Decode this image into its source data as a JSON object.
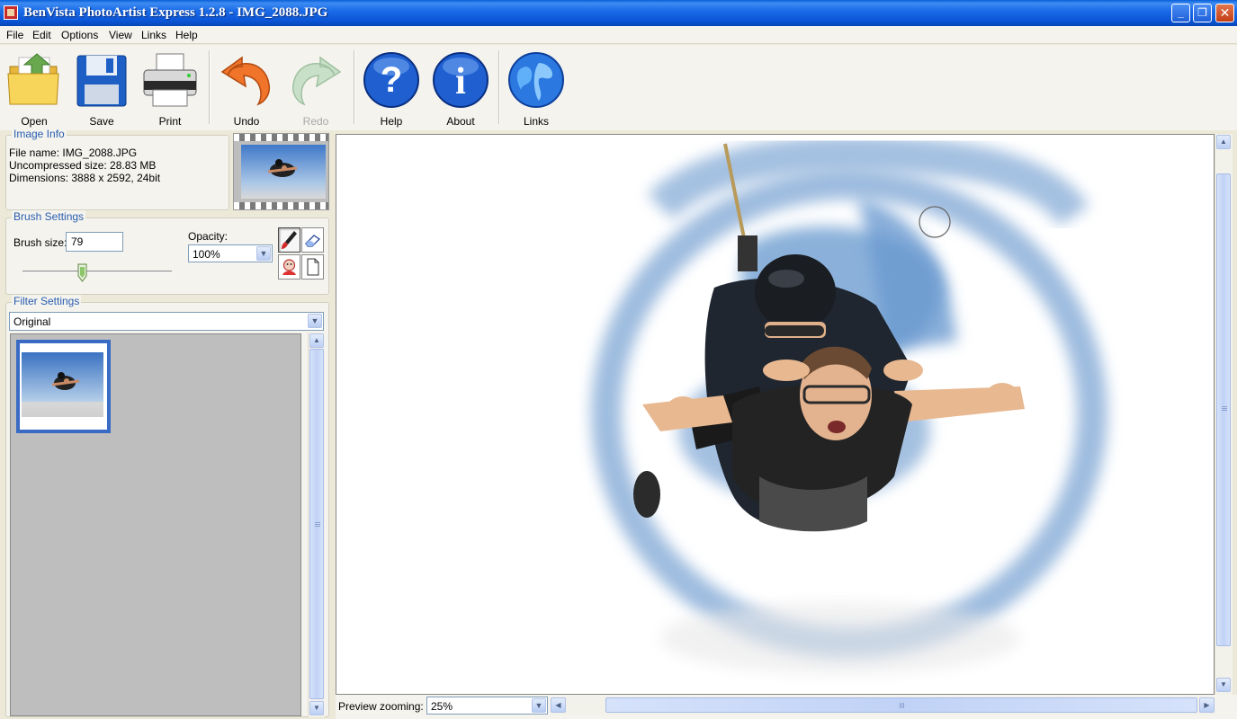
{
  "window": {
    "title": "BenVista PhotoArtist Express 1.2.8 - IMG_2088.JPG",
    "minimize_glyph": "_",
    "maximize_glyph": "❐",
    "close_glyph": "✕"
  },
  "menu": [
    "File",
    "Edit",
    "Options",
    "View",
    "Links",
    "Help"
  ],
  "toolbar": {
    "open": "Open",
    "save": "Save",
    "print": "Print",
    "undo": "Undo",
    "redo": "Redo",
    "help": "Help",
    "about": "About",
    "links": "Links",
    "icons": [
      "folder-icon",
      "floppy-disk-icon",
      "printer-icon",
      "undo-arrow-icon",
      "redo-arrow-icon",
      "question-mark-icon",
      "info-icon",
      "globe-icon"
    ]
  },
  "image_info": {
    "title": "Image Info",
    "file_name": "File name: IMG_2088.JPG",
    "uncompressed_size": "Uncompressed size: 28.83 MB",
    "dimensions": "Dimensions: 3888 x 2592, 24bit"
  },
  "brush": {
    "title": "Brush Settings",
    "size_label": "Brush size:",
    "size_value": "79",
    "size_slider_fraction": 0.4,
    "opacity_label": "Opacity:",
    "opacity_value": "100%",
    "tool_icons": [
      "brush-icon",
      "eraser-icon",
      "face-stamp-icon",
      "blank-page-icon"
    ]
  },
  "filter": {
    "title": "Filter Settings",
    "selected": "Original"
  },
  "preview": {
    "zoom_label": "Preview zooming:",
    "zoom_value": "25%"
  },
  "colors": {
    "titlebar": "#0a55d6",
    "group_title": "#2a5db0",
    "selection_border": "#3a6bc4",
    "sky": "#7fa9d6"
  }
}
